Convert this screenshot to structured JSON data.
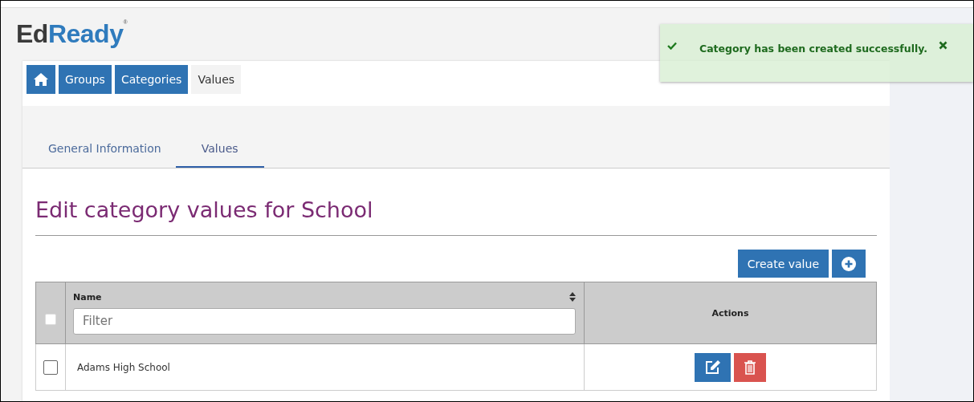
{
  "logo": {
    "part_1": "Ed",
    "part_2": "Ready",
    "mark": "®"
  },
  "toast": {
    "message": "Category has been created successfully."
  },
  "breadcrumbs": [
    {
      "kind": "home",
      "selected": false
    },
    {
      "kind": "link",
      "label": "Groups",
      "selected": false
    },
    {
      "kind": "link",
      "label": "Categories",
      "selected": false
    },
    {
      "kind": "link",
      "label": "Values",
      "selected": true
    }
  ],
  "tabs": [
    {
      "label": "General Information",
      "selected": false
    },
    {
      "label": "Values",
      "selected": true
    }
  ],
  "heading": "Edit category values for School",
  "create_button": "Create value",
  "table": {
    "columns": [
      {
        "label": "Name",
        "filter_placeholder": "Filter"
      },
      {
        "label": "Actions"
      }
    ],
    "select_all_checked": false,
    "rows": [
      {
        "name": "Adams High School",
        "checked": false
      }
    ]
  }
}
